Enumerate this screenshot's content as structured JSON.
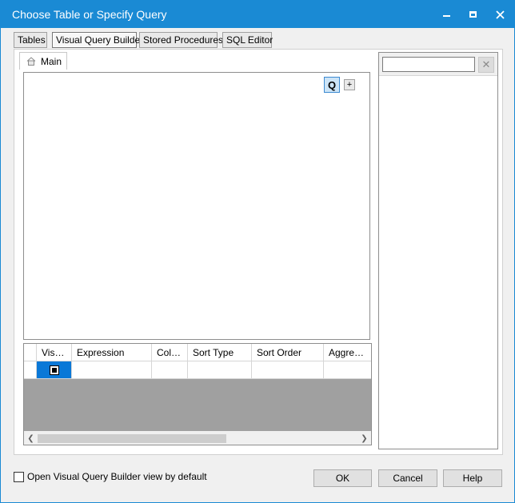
{
  "window": {
    "title": "Choose Table or Specify Query"
  },
  "tabs": [
    {
      "label": "Tables"
    },
    {
      "label": "Visual Query Builder"
    },
    {
      "label": "Stored Procedures"
    },
    {
      "label": "SQL Editor"
    }
  ],
  "active_tab": "Visual Query Builder",
  "inner_tab": {
    "label": "Main"
  },
  "diagram": {
    "q_label": "Q",
    "plus_label": "+"
  },
  "grid": {
    "columns": [
      "Visible",
      "Expression",
      "Colu...",
      "Sort Type",
      "Sort Order",
      "Aggregate"
    ],
    "rows": [
      {
        "visible": true,
        "expression": "",
        "column": "",
        "sort_type": "",
        "sort_order": "",
        "aggregate": ""
      }
    ]
  },
  "side_panel": {
    "search_value": "",
    "clear_label": "✕"
  },
  "footer": {
    "checkbox_label": "Open Visual Query Builder view by default",
    "checkbox_checked": false,
    "ok_label": "OK",
    "cancel_label": "Cancel",
    "help_label": "Help"
  },
  "colors": {
    "titlebar": "#1a8ad4",
    "selection": "#0a78d7",
    "grid_empty": "#a0a0a0"
  }
}
